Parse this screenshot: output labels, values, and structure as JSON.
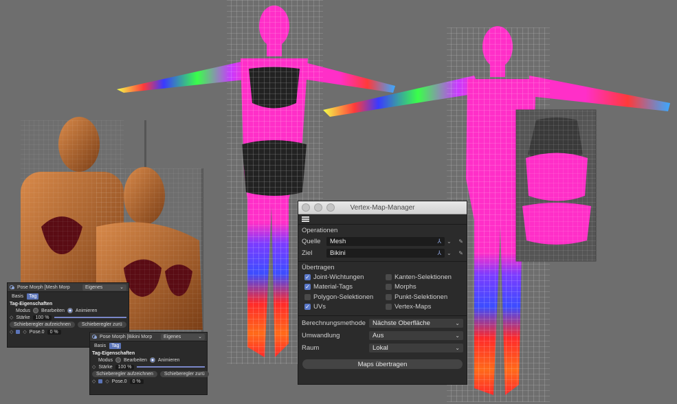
{
  "vertex_map_manager": {
    "title": "Vertex-Map-Manager",
    "menu_icon": "hamburger-menu-icon",
    "operations_label": "Operationen",
    "source_label": "Quelle",
    "source_value": "Mesh",
    "target_label": "Ziel",
    "target_value": "Bikini",
    "transfer_label": "Übertragen",
    "options": [
      {
        "label": "Joint-Wichtungen",
        "checked": true
      },
      {
        "label": "Kanten-Selektionen",
        "checked": false
      },
      {
        "label": "Material-Tags",
        "checked": true
      },
      {
        "label": "Morphs",
        "checked": false
      },
      {
        "label": "Polygon-Selektionen",
        "checked": false
      },
      {
        "label": "Punkt-Selektionen",
        "checked": false
      },
      {
        "label": "UVs",
        "checked": true
      },
      {
        "label": "Vertex-Maps",
        "checked": false
      }
    ],
    "calc_method_label": "Berechnungsmethode",
    "calc_method_value": "Nächste Oberfläche",
    "conversion_label": "Umwandlung",
    "conversion_value": "Aus",
    "space_label": "Raum",
    "space_value": "Lokal",
    "transfer_button": "Maps übertragen"
  },
  "pose_panel_1": {
    "title": "Pose Morph [Mesh Morp",
    "mode_dropdown": "Eigenes",
    "tab_basis": "Basis",
    "tab_tag": "Tag",
    "section": "Tag-Eigenschaften",
    "mode_label": "Modus",
    "mode_edit": "Bearbeiten",
    "mode_animate": "Animieren",
    "strength_label": "Stärke",
    "strength_value": "100 %",
    "record_button": "Schieberegler aufzeichnen",
    "reset_button": "Schieberegler zurü",
    "pose_label": "Pose.0",
    "pose_value": "0 %"
  },
  "pose_panel_2": {
    "title": "Pose Morph [Bikini Morp",
    "mode_dropdown": "Eigenes",
    "tab_basis": "Basis",
    "tab_tag": "Tag",
    "section": "Tag-Eigenschaften",
    "mode_label": "Modus",
    "mode_edit": "Bearbeiten",
    "mode_animate": "Animieren",
    "strength_label": "Stärke",
    "strength_value": "100 %",
    "record_button": "Schieberegler aufzeichnen",
    "reset_button": "Schieberegler zurü",
    "pose_label": "Pose.0",
    "pose_value": "0 %"
  },
  "colors": {
    "viewport_bg": "#6e6e6e",
    "accent": "#5a78c8",
    "panel_bg": "#2b2b2b"
  }
}
